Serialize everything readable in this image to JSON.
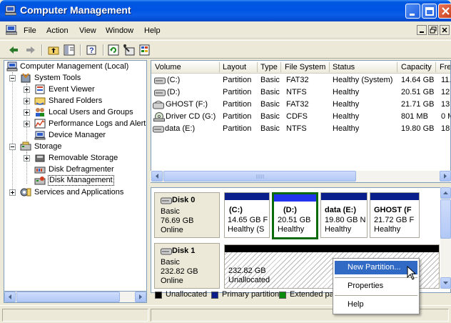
{
  "window": {
    "title": "Computer Management",
    "accent": "#0054e3"
  },
  "menubar": {
    "items": [
      "File",
      "Action",
      "View",
      "Window",
      "Help"
    ]
  },
  "tree": {
    "root": "Computer Management (Local)",
    "system_tools": "System Tools",
    "event_viewer": "Event Viewer",
    "shared_folders": "Shared Folders",
    "local_users": "Local Users and Groups",
    "perf_logs": "Performance Logs and Alerts",
    "device_manager": "Device Manager",
    "storage": "Storage",
    "removable_storage": "Removable Storage",
    "disk_defrag": "Disk Defragmenter",
    "disk_management": "Disk Management",
    "services_apps": "Services and Applications"
  },
  "volumes": {
    "columns": [
      "Volume",
      "Layout",
      "Type",
      "File System",
      "Status",
      "Capacity",
      "Fre"
    ],
    "rows": [
      [
        "(C:)",
        "Partition",
        "Basic",
        "FAT32",
        "Healthy (System)",
        "14.64 GB",
        "11."
      ],
      [
        "(D:)",
        "Partition",
        "Basic",
        "NTFS",
        "Healthy",
        "20.51 GB",
        "12."
      ],
      [
        "GHOST (F:)",
        "Partition",
        "Basic",
        "FAT32",
        "Healthy",
        "21.71 GB",
        "13."
      ],
      [
        "Driver CD (G:)",
        "Partition",
        "Basic",
        "CDFS",
        "Healthy",
        "801 MB",
        "0 M"
      ],
      [
        "data (E:)",
        "Partition",
        "Basic",
        "NTFS",
        "Healthy",
        "19.80 GB",
        "18."
      ]
    ]
  },
  "disks": [
    {
      "name": "Disk 0",
      "type": "Basic",
      "size": "76.69 GB",
      "state": "Online",
      "partitions": [
        {
          "name": "(C:)",
          "size": "14.65 GB F",
          "status": "Healthy (S"
        },
        {
          "name": "(D:)",
          "size": "20.51 GB",
          "status": "Healthy"
        },
        {
          "name": "data  (E:)",
          "size": "19.80 GB N",
          "status": "Healthy"
        },
        {
          "name": "GHOST  (F",
          "size": "21.72 GB F",
          "status": "Healthy"
        }
      ]
    },
    {
      "name": "Disk 1",
      "type": "Basic",
      "size": "232.82 GB",
      "state": "Online",
      "unallocated": {
        "size": "232.82 GB",
        "label": "Unallocated"
      }
    }
  ],
  "legend": [
    {
      "label": "Unallocated",
      "color": "#000000"
    },
    {
      "label": "Primary partition",
      "color": "#0a1e8c"
    },
    {
      "label": "Extended pa",
      "color": "#0b8b0b"
    }
  ],
  "context_menu": {
    "new_partition": "New Partition...",
    "properties": "Properties",
    "help": "Help"
  }
}
